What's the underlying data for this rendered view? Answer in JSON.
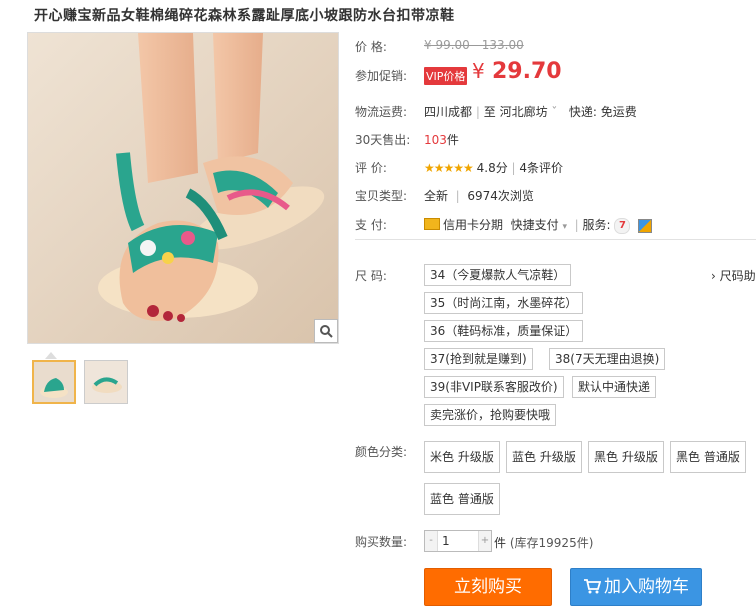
{
  "title": "开心赚宝新品女鞋棉绳碎花森林系露趾厚底小坡跟防水台扣带凉鞋",
  "price": {
    "label": "价      格:",
    "original": "¥ 99.00 - 133.00",
    "promo_label": "参加促销:",
    "vip_badge": "VIP价格",
    "currency": "¥",
    "current": "29.70"
  },
  "shipping": {
    "label": "物流运费:",
    "from": "四川成都",
    "separator": "|",
    "to_prefix": "至",
    "to": "河北廊坊",
    "dropdown": "ˇ",
    "fee": "快递: 免运费"
  },
  "sales": {
    "label": "30天售出:",
    "count": "103",
    "unit": "件"
  },
  "rating": {
    "label": "评      价:",
    "stars": "★★★★★",
    "score": "4.8分",
    "separator": "|",
    "reviews": "4条评价"
  },
  "type": {
    "label": "宝贝类型:",
    "value": "全新",
    "separator": "|",
    "views": "6974次浏览"
  },
  "payment": {
    "label": "支      付:",
    "credit": "信用卡分期",
    "quick": "快捷支付",
    "more": "▾",
    "separator": "|",
    "service_label": "服务:",
    "service_badge": "7"
  },
  "size": {
    "label": "尺      码:",
    "chart_link": "› 尺码助",
    "options": [
      "34（今夏爆款人气凉鞋）",
      "35（时尚江南，水墨碎花）",
      "36（鞋码标准，质量保证）",
      "37(抢到就是赚到)",
      "38(7天无理由退换)",
      "39(非VIP联系客服改价)",
      "默认中通快递",
      "卖完涨价，抢购要快哦"
    ]
  },
  "color": {
    "label": "颜色分类:",
    "options": [
      "米色 升级版",
      "蓝色 升级版",
      "黑色 升级版",
      "黑色 普通版",
      "蓝色 普通版"
    ]
  },
  "quantity": {
    "label": "购买数量:",
    "minus": "-",
    "value": "1",
    "plus": "+",
    "unit": "件",
    "stock": "(库存19925件)"
  },
  "buttons": {
    "buy_now": "立刻购买",
    "add_cart": "加入购物车"
  },
  "colors": {
    "price_red": "#e4393c",
    "buy_orange": "#ff6c00",
    "cart_blue": "#3b95e3",
    "star_gold": "#f0a500"
  }
}
